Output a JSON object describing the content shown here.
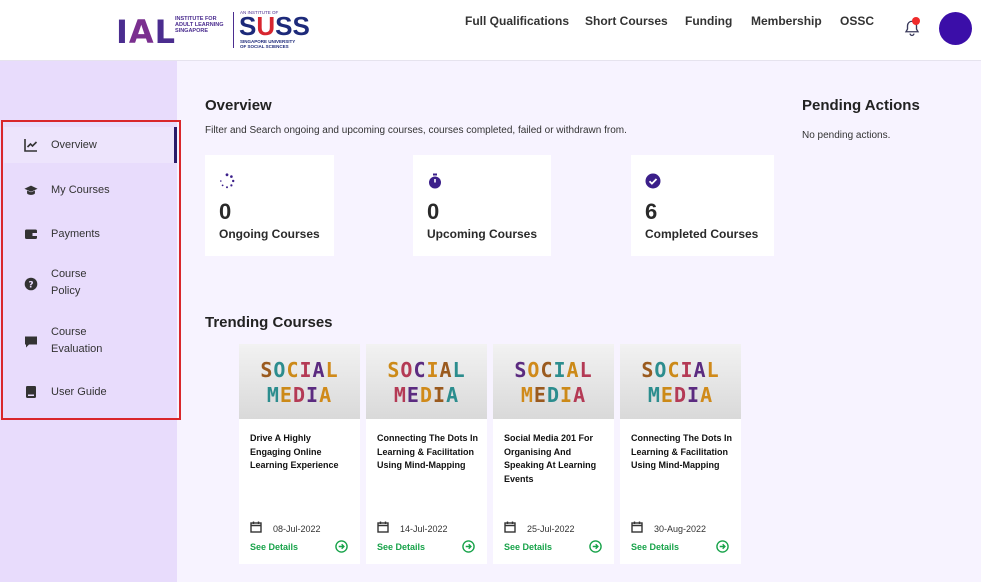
{
  "header": {
    "logo_ial": "IAL",
    "logo_ial_sub": [
      "INSTITUTE FOR",
      "ADULT LEARNING",
      "SINGAPORE"
    ],
    "logo_suss_top": "AN INSTITUTE OF",
    "logo_suss": "SUSS",
    "logo_suss_sub": [
      "SINGAPORE UNIVERSITY",
      "OF SOCIAL SCIENCES"
    ],
    "nav": [
      "Full Qualifications",
      "Short Courses",
      "Funding",
      "Membership",
      "OSSC"
    ],
    "icons": [
      "bell-icon",
      "avatar"
    ],
    "colors": {
      "avatar": "#3b0ea8",
      "notification_dot": "#ef2b2b"
    }
  },
  "sidebar": {
    "items": [
      {
        "label": "Overview",
        "icon": "chart-line-icon",
        "active": true
      },
      {
        "label": "My Courses",
        "icon": "graduation-cap-icon"
      },
      {
        "label": "Payments",
        "icon": "wallet-icon"
      },
      {
        "label": "Course Policy",
        "lines": [
          "Course",
          "Policy"
        ],
        "icon": "question-circle-icon"
      },
      {
        "label": "Course Evaluation",
        "lines": [
          "Course",
          "Evaluation"
        ],
        "icon": "comment-icon"
      },
      {
        "label": "User Guide",
        "icon": "book-icon"
      }
    ]
  },
  "overview": {
    "title": "Overview",
    "subtitle": "Filter and Search ongoing and upcoming courses, courses completed, failed or withdrawn from.",
    "stats": [
      {
        "icon": "spinner-icon",
        "value": "0",
        "label": "Ongoing Courses"
      },
      {
        "icon": "stopwatch-icon",
        "value": "0",
        "label": "Upcoming Courses"
      },
      {
        "icon": "check-circle-icon",
        "value": "6",
        "label": "Completed Courses"
      }
    ]
  },
  "pending": {
    "title": "Pending Actions",
    "text": "No pending actions."
  },
  "trending": {
    "title": "Trending Courses",
    "image_word1": "SOCIAL",
    "image_word2": "MEDIA",
    "see_details": "See Details",
    "courses": [
      {
        "title": "Drive A Highly Engaging Online Learning Experience",
        "date": "08-Jul-2022"
      },
      {
        "title": "Connecting The Dots In Learning & Facilitation Using Mind-Mapping",
        "date": "14-Jul-2022"
      },
      {
        "title": "Social Media 201 For Organising And Speaking At Learning Events",
        "date": "25-Jul-2022"
      },
      {
        "title": "Connecting The Dots In Learning & Facilitation Using Mind-Mapping",
        "date": "30-Aug-2022"
      }
    ]
  }
}
